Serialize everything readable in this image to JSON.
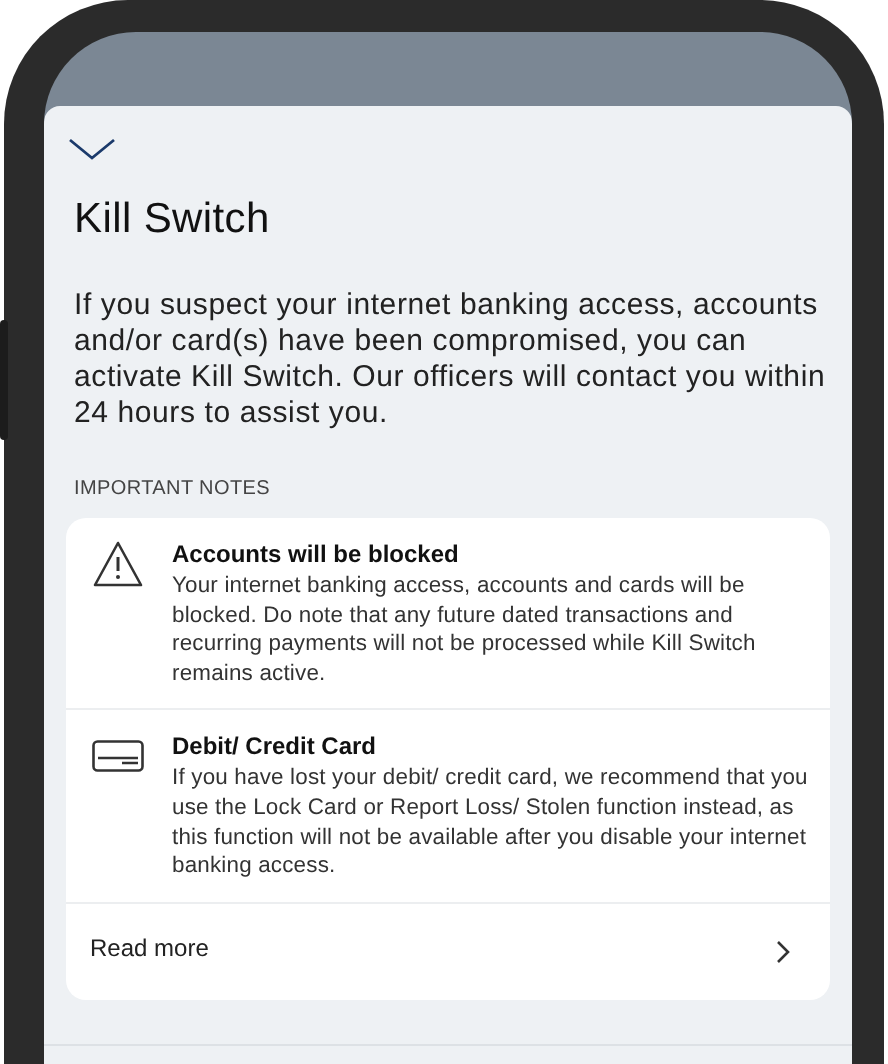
{
  "title": "Kill Switch",
  "description": "If you suspect your internet banking access, accounts and/or card(s) have been compromised, you can activate Kill Switch. Our officers will contact you within 24 hours to assist you.",
  "section_heading": "IMPORTANT NOTES",
  "notes": [
    {
      "kind": "warning",
      "heading": "Accounts will be blocked",
      "text": "Your internet banking access, accounts and cards will be blocked. Do note that any future dated transactions and recurring payments will not be processed while Kill Switch remains active."
    },
    {
      "kind": "card",
      "heading": "Debit/ Credit Card",
      "text": "If you have lost your debit/ credit card, we recommend that you use the Lock Card or Report Loss/ Stolen function instead, as this function will not be available after you disable your internet banking access."
    }
  ],
  "read_more": "Read more"
}
